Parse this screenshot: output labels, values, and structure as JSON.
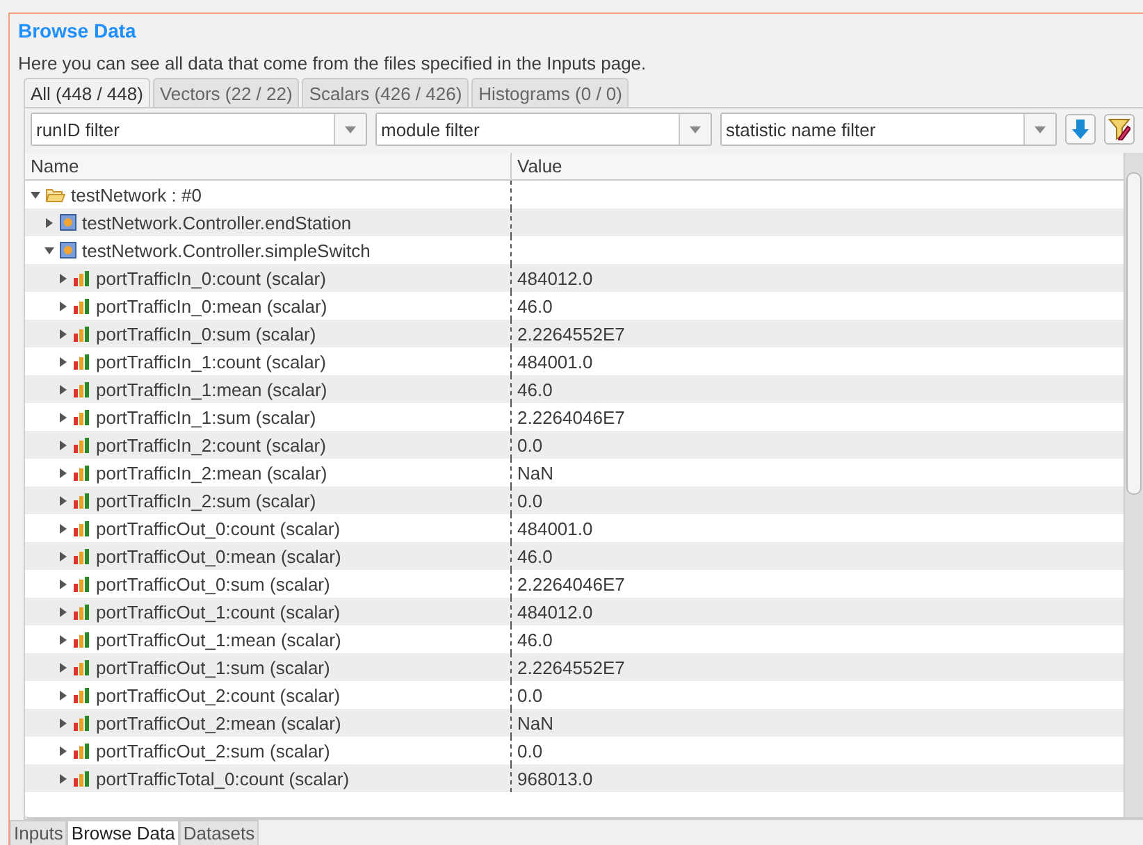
{
  "title": "Browse Data",
  "description": "Here you can see all data that come from the files specified in the Inputs page.",
  "tabs": [
    {
      "label": "All (448 / 448)",
      "selected": true
    },
    {
      "label": "Vectors (22 / 22)",
      "selected": false
    },
    {
      "label": "Scalars (426 / 426)",
      "selected": false
    },
    {
      "label": "Histograms (0 / 0)",
      "selected": false
    }
  ],
  "filters": [
    {
      "placeholder": "runID filter"
    },
    {
      "placeholder": "module filter"
    },
    {
      "placeholder": "statistic name filter"
    }
  ],
  "table": {
    "columns": [
      "Name",
      "Value"
    ],
    "rows": [
      {
        "kind": "folder",
        "name": "testNetwork : #0",
        "expanded": true,
        "children": [
          {
            "kind": "module",
            "name": "testNetwork.Controller.endStation",
            "expanded": false
          },
          {
            "kind": "module",
            "name": "testNetwork.Controller.simpleSwitch",
            "expanded": true,
            "children": [
              {
                "kind": "scalar",
                "name": "portTrafficIn_0:count (scalar)",
                "value": "484012.0"
              },
              {
                "kind": "scalar",
                "name": "portTrafficIn_0:mean (scalar)",
                "value": "46.0"
              },
              {
                "kind": "scalar",
                "name": "portTrafficIn_0:sum (scalar)",
                "value": "2.2264552E7"
              },
              {
                "kind": "scalar",
                "name": "portTrafficIn_1:count (scalar)",
                "value": "484001.0"
              },
              {
                "kind": "scalar",
                "name": "portTrafficIn_1:mean (scalar)",
                "value": "46.0"
              },
              {
                "kind": "scalar",
                "name": "portTrafficIn_1:sum (scalar)",
                "value": "2.2264046E7"
              },
              {
                "kind": "scalar",
                "name": "portTrafficIn_2:count (scalar)",
                "value": "0.0"
              },
              {
                "kind": "scalar",
                "name": "portTrafficIn_2:mean (scalar)",
                "value": "NaN"
              },
              {
                "kind": "scalar",
                "name": "portTrafficIn_2:sum (scalar)",
                "value": "0.0"
              },
              {
                "kind": "scalar",
                "name": "portTrafficOut_0:count (scalar)",
                "value": "484001.0"
              },
              {
                "kind": "scalar",
                "name": "portTrafficOut_0:mean (scalar)",
                "value": "46.0"
              },
              {
                "kind": "scalar",
                "name": "portTrafficOut_0:sum (scalar)",
                "value": "2.2264046E7"
              },
              {
                "kind": "scalar",
                "name": "portTrafficOut_1:count (scalar)",
                "value": "484012.0"
              },
              {
                "kind": "scalar",
                "name": "portTrafficOut_1:mean (scalar)",
                "value": "46.0"
              },
              {
                "kind": "scalar",
                "name": "portTrafficOut_1:sum (scalar)",
                "value": "2.2264552E7"
              },
              {
                "kind": "scalar",
                "name": "portTrafficOut_2:count (scalar)",
                "value": "0.0"
              },
              {
                "kind": "scalar",
                "name": "portTrafficOut_2:mean (scalar)",
                "value": "NaN"
              },
              {
                "kind": "scalar",
                "name": "portTrafficOut_2:sum (scalar)",
                "value": "0.0"
              },
              {
                "kind": "scalar",
                "name": "portTrafficTotal_0:count (scalar)",
                "value": "968013.0"
              }
            ]
          }
        ]
      }
    ]
  },
  "bottom_tabs": [
    {
      "label": "Inputs",
      "selected": false
    },
    {
      "label": "Browse Data",
      "selected": true
    },
    {
      "label": "Datasets",
      "selected": false
    }
  ]
}
